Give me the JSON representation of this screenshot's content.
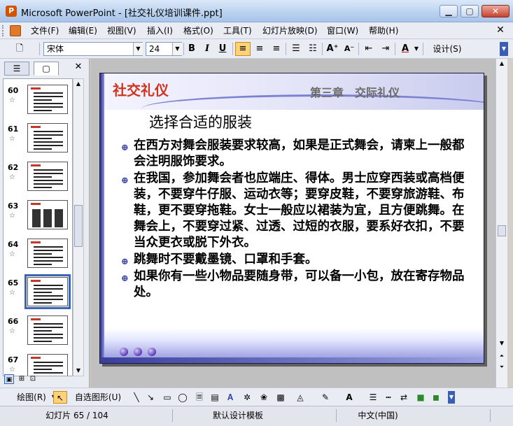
{
  "window": {
    "title": "Microsoft PowerPoint - [社交礼仪培训课件.ppt]",
    "logo_glyph": "P"
  },
  "menu": {
    "items": [
      "文件(F)",
      "编辑(E)",
      "视图(V)",
      "插入(I)",
      "格式(O)",
      "工具(T)",
      "幻灯片放映(D)",
      "窗口(W)",
      "帮助(H)"
    ],
    "close_glyph": "✕"
  },
  "toolbar": {
    "font_name": "宋体",
    "font_size": "24",
    "bold": "B",
    "italic": "I",
    "underline": "U",
    "design_label": "设计(S)"
  },
  "left_panel": {
    "tab_outline": "☰",
    "tab_slides": "▢",
    "close_glyph": "✕",
    "star_glyph": "☆",
    "slides": [
      {
        "num": "60",
        "selected": false,
        "has_image": false
      },
      {
        "num": "61",
        "selected": false,
        "has_image": false
      },
      {
        "num": "62",
        "selected": false,
        "has_image": false
      },
      {
        "num": "63",
        "selected": false,
        "has_image": true
      },
      {
        "num": "64",
        "selected": false,
        "has_image": false
      },
      {
        "num": "65",
        "selected": true,
        "has_image": false
      },
      {
        "num": "66",
        "selected": false,
        "has_image": false
      },
      {
        "num": "67",
        "selected": false,
        "has_image": false
      }
    ]
  },
  "slide": {
    "brand": "社交礼仪",
    "chapter": "第三章　交际礼仪",
    "title": "选择合适的服装",
    "bullet_glyph": "⊕",
    "bullets": [
      "在西方对舞会服装要求较高，如果是正式舞会，请柬上一般都会注明服饰要求。",
      "在我国，参加舞会者也应端庄、得体。男士应穿西装或高档便装，不要穿牛仔服、运动衣等；要穿皮鞋，不要穿旅游鞋、布鞋，更不要穿拖鞋。女士一般应以裙装为宜，且方便跳舞。在舞会上，不要穿过紧、过透、过短的衣服，要系好衣扣，不要当众更衣或脱下外衣。",
      "跳舞时不要戴墨镜、口罩和手套。",
      "如果你有一些小物品要随身带，可以备一小包，放在寄存物品处。"
    ]
  },
  "drawbar": {
    "draw_label": "绘图(R)",
    "autoshape_label": "自选图形(U)"
  },
  "status": {
    "slide_pos": "幻灯片 65 / 104",
    "template": "默认设计模板",
    "language": "中文(中国)"
  },
  "colors": {
    "accent_red": "#d0321e",
    "theme_blue": "#3b3f9c",
    "selection": "#3a66b4"
  }
}
